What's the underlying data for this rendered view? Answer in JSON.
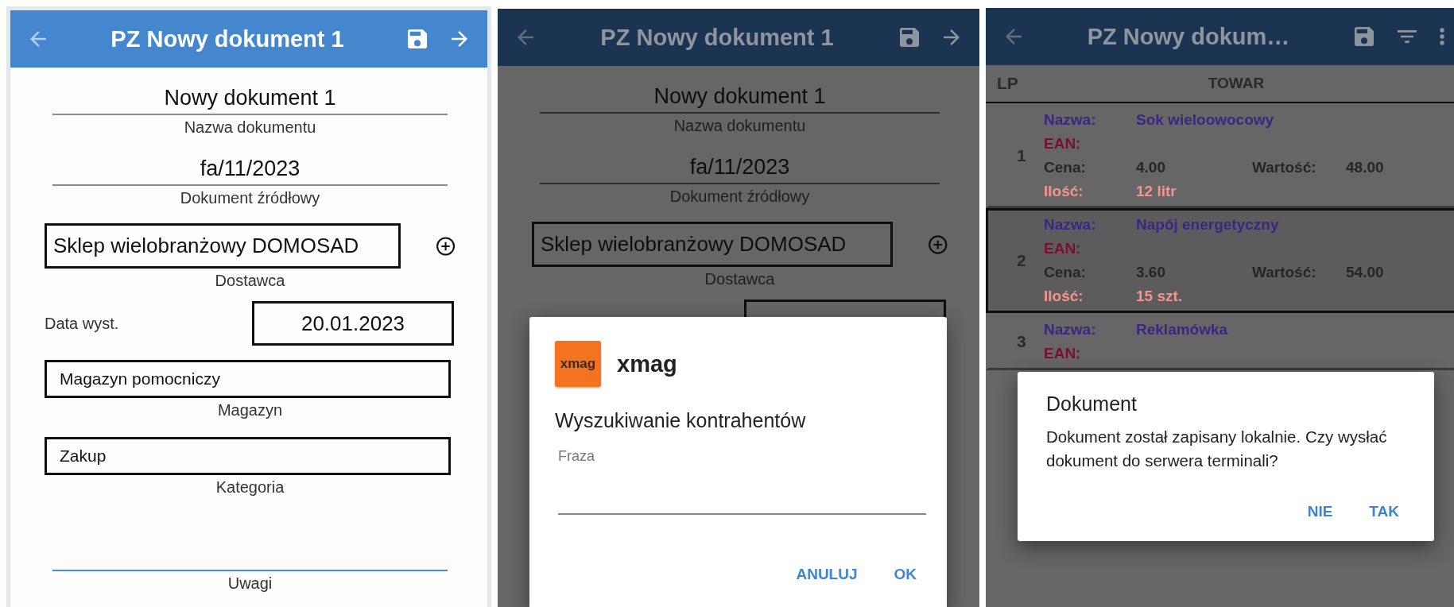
{
  "screens": [
    {
      "kind": "form",
      "dimmed": false,
      "appbar": {
        "title": "PZ Nowy dokument 1",
        "actions": [
          {
            "kind": "back",
            "disabled": true
          },
          {
            "kind": "save",
            "disabled": false
          },
          {
            "kind": "forward",
            "disabled": false
          }
        ]
      },
      "fields": [
        {
          "kind": "underline",
          "value": "Nowy dokument 1",
          "label": "Nazwa dokumentu"
        },
        {
          "kind": "underline",
          "value": "fa/11/2023",
          "label": "Dokument źródłowy"
        },
        {
          "kind": "boxed-plus",
          "value": "Sklep wielobranżowy DOMOSAD",
          "label": "Dostawca"
        },
        {
          "kind": "date",
          "label": "Data wyst.",
          "value": "20.01.2023"
        },
        {
          "kind": "boxed",
          "value": "Magazyn pomocniczy",
          "label": "Magazyn"
        },
        {
          "kind": "boxed",
          "value": "Zakup",
          "label": "Kategoria"
        },
        {
          "kind": "note",
          "label": "Uwagi",
          "focused": true
        }
      ]
    },
    {
      "kind": "form",
      "dimmed": true,
      "appbar": {
        "title": "PZ Nowy dokument 1",
        "actions": [
          {
            "kind": "back",
            "disabled": true
          },
          {
            "kind": "save",
            "disabled": false
          },
          {
            "kind": "forward",
            "disabled": false
          }
        ]
      },
      "fields": [
        {
          "kind": "underline",
          "value": "Nowy dokument 1",
          "label": "Nazwa dokumentu"
        },
        {
          "kind": "underline",
          "value": "fa/11/2023",
          "label": "Dokument źródłowy"
        },
        {
          "kind": "boxed-plus",
          "value": "Sklep wielobranżowy DOMOSAD",
          "label": "Dostawca"
        },
        {
          "kind": "date"
        }
      ],
      "dialog": {
        "kind": "search",
        "app_icon_text": "xmag",
        "app_name": "xmag",
        "title": "Wyszukiwanie kontrahentów",
        "input": {
          "label": "Fraza"
        },
        "buttons": [
          "ANULUJ",
          "OK"
        ]
      }
    },
    {
      "kind": "list",
      "dimmed": true,
      "appbar": {
        "title": "PZ Nowy dokum…",
        "actions": [
          {
            "kind": "back",
            "disabled": true
          },
          {
            "kind": "save",
            "disabled": false
          },
          {
            "kind": "filter",
            "disabled": false
          },
          {
            "kind": "more",
            "disabled": false
          }
        ]
      },
      "table": {
        "columns": [
          "LP",
          "TOWAR"
        ],
        "rows": [
          {
            "lp": "1",
            "selected": false,
            "lines": [
              {
                "kind": "name",
                "label": "Nazwa:",
                "value": "Sok wieloowocowy"
              },
              {
                "kind": "ean",
                "label": "EAN:"
              },
              {
                "kind": "price",
                "label": "Cena:",
                "value": "4.00",
                "extra_label": "Wartość:",
                "extra_value": "48.00"
              },
              {
                "kind": "qty",
                "label": "Ilość:",
                "value": "12 litr"
              }
            ]
          },
          {
            "lp": "2",
            "selected": true,
            "lines": [
              {
                "kind": "name",
                "label": "Nazwa:",
                "value": "Napój energetyczny"
              },
              {
                "kind": "ean",
                "label": "EAN:"
              },
              {
                "kind": "price",
                "label": "Cena:",
                "value": "3.60",
                "extra_label": "Wartość:",
                "extra_value": "54.00"
              },
              {
                "kind": "qty",
                "label": "Ilość:",
                "value": "15 szt."
              }
            ]
          },
          {
            "lp": "3",
            "selected": false,
            "lines": [
              {
                "kind": "name",
                "label": "Nazwa:",
                "value": "Reklamówka"
              },
              {
                "kind": "ean",
                "label": "EAN:"
              }
            ]
          }
        ]
      },
      "dialog": {
        "kind": "alert",
        "title": "Dokument",
        "message": "Dokument został zapisany lokalnie. Czy wysłać dokument do serwera terminali?",
        "buttons": [
          "NIE",
          "TAK"
        ]
      }
    }
  ]
}
